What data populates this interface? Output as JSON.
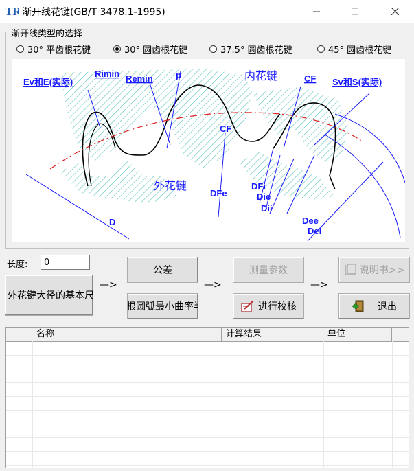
{
  "window": {
    "title": "渐开线花键(GB/T 3478.1-1995)",
    "logo_text": "TR"
  },
  "spline_type": {
    "group_label": "渐开线类型的选择",
    "options": [
      {
        "label": "30° 平齿根花键",
        "selected": false
      },
      {
        "label": "30° 圆齿根花键",
        "selected": true
      },
      {
        "label": "37.5° 圆齿根花键",
        "selected": false
      },
      {
        "label": "45° 圆齿根花键",
        "selected": false
      }
    ]
  },
  "diagram": {
    "labels": {
      "ev_e": "Ev和E(实际)",
      "rimin": "Rimin",
      "remin": "Remin",
      "p": "p",
      "inner": "内花键",
      "cf_top": "CF",
      "sv_s": "Sv和S(实际)",
      "cf_mid": "CF",
      "outer": "外花键",
      "dfe": "DFe",
      "dfi": "DFi",
      "die": "Die",
      "dii": "Dii",
      "d": "D",
      "dee": "Dee",
      "dei": "Dei"
    }
  },
  "length": {
    "label": "长度:",
    "value": "0"
  },
  "buttons": {
    "basic": "外花键大径的基本尺",
    "tolerance": "公差",
    "arc": "根圆弧最小曲率半",
    "measure": "测量参数",
    "check": "进行校核",
    "manual": "说明书>>",
    "exit": "退出"
  },
  "arrows": {
    "a1": "—>",
    "a2": "—>",
    "a3": "—>"
  },
  "results_table": {
    "columns": [
      "名称",
      "计算结果",
      "单位"
    ],
    "rows": []
  }
}
